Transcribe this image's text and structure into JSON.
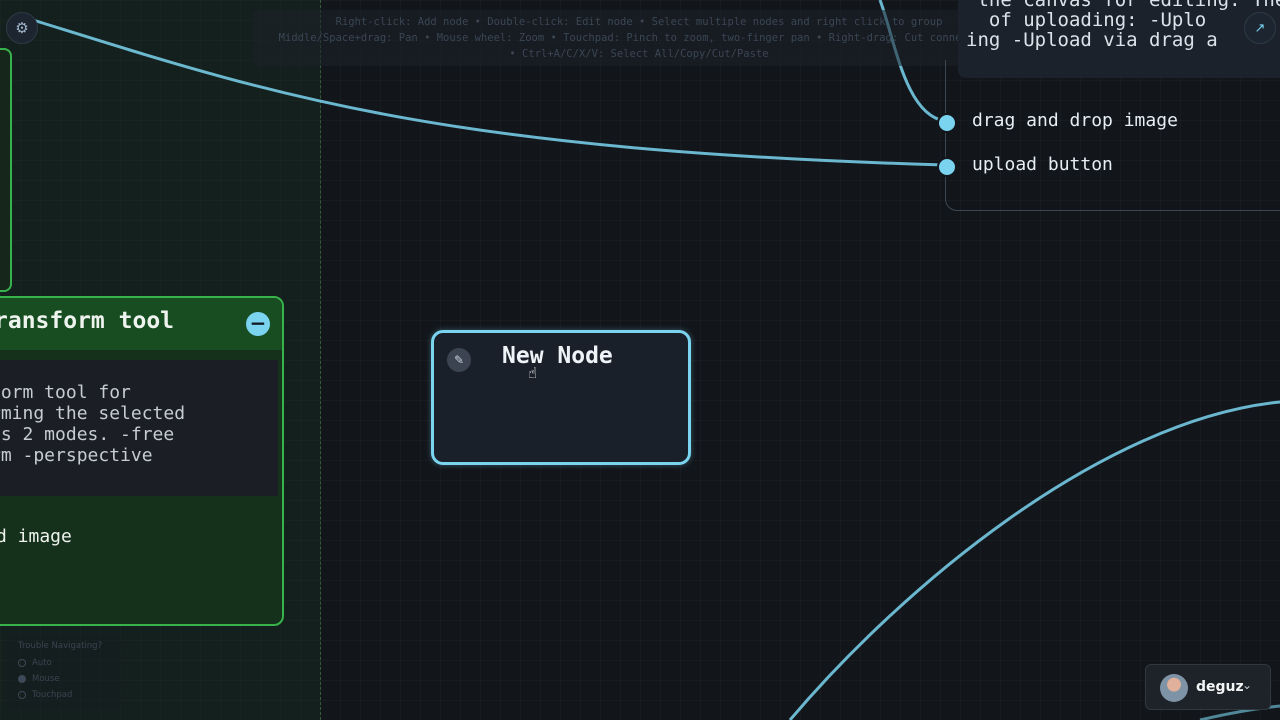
{
  "help_banner": {
    "lines": [
      "Right-click: Add node • Double-click: Edit node • Select multiple nodes and right click to group",
      "Middle/Space+drag: Pan • Mouse wheel: Zoom • Touchpad: Pinch to zoom, two-finger pan • Right-drag: Cut connections",
      "• Ctrl+A/C/X/V: Select All/Copy/Cut/Paste"
    ]
  },
  "toolbar": {
    "settings_icon": "gear-icon",
    "settings_glyph": "⚙",
    "expand_icon": "expand-arrow-icon",
    "expand_glyph": "↗"
  },
  "nodes": {
    "transform_tool": {
      "title": "ransform tool",
      "collapse_glyph": "−",
      "description": "form tool for\nrming the selected\nns 2 modes. -free\nrm -perspective",
      "port_label": "d image",
      "accent_color": "#38b24a"
    },
    "new_node": {
      "title": "New Node",
      "edit_glyph": "✎",
      "accent_color": "#7ad3ef"
    },
    "upload_node": {
      "description": " the canvas for editing. The\n  of uploading: -Uplo\ning -Upload via drag a",
      "ports": [
        {
          "label": "drag and drop image"
        },
        {
          "label": "upload button"
        }
      ]
    }
  },
  "navigation_help": {
    "heading": "Trouble Navigating?",
    "options": [
      {
        "label": "Auto",
        "selected": false
      },
      {
        "label": "Mouse",
        "selected": true
      },
      {
        "label": "Touchpad",
        "selected": false
      }
    ]
  },
  "user": {
    "name": "deguz",
    "chevron": "⌄"
  },
  "colors": {
    "canvas_bg": "#12161b",
    "edge": "#7ad3ef",
    "group_border": "#38b24a"
  }
}
